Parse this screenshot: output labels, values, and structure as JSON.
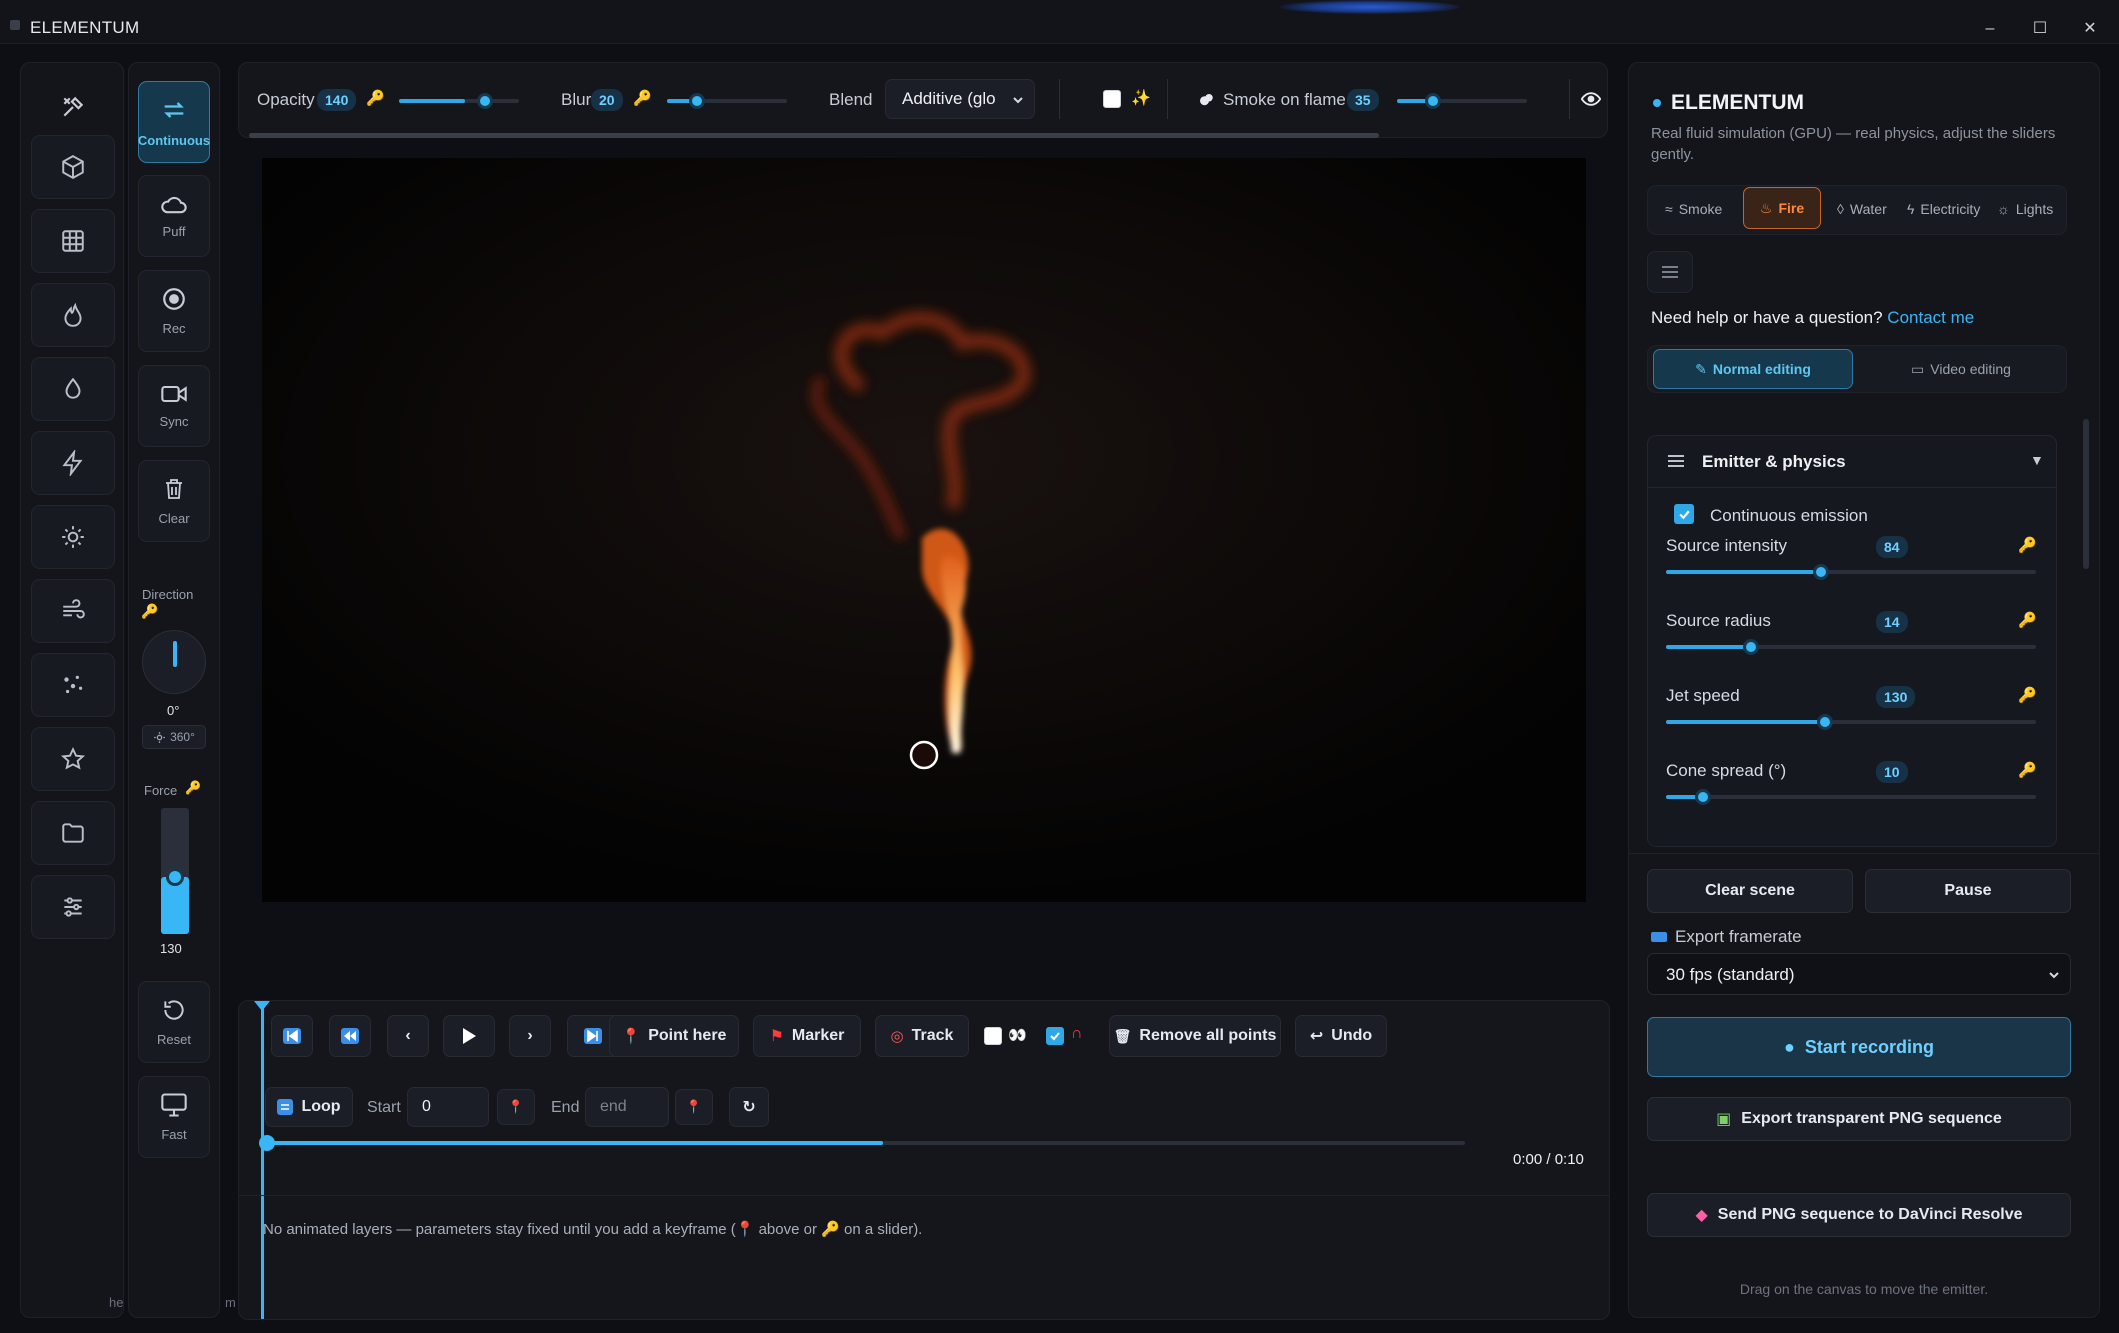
{
  "window": {
    "title": "ELEMENTUM",
    "controls": [
      "–",
      "☐",
      "✕"
    ]
  },
  "left_rail": {
    "icons": [
      "tools-icon",
      "cube-icon",
      "grid-icon",
      "flame-icon",
      "droplet-icon",
      "bolt-icon",
      "sun-icon",
      "wind-icon",
      "particles-icon",
      "star-icon",
      "folder-icon",
      "sliders-icon"
    ],
    "footer_label": "he"
  },
  "tools": {
    "continuous": "Continuous",
    "puff": "Puff",
    "rec": "Rec",
    "sync": "Sync",
    "clear": "Clear",
    "direction_label": "Direction",
    "direction_value": "0°",
    "direction_360": "360°",
    "force_label": "Force",
    "force_value": "130",
    "force_level": 0.45,
    "reset": "Reset",
    "fast": "Fast",
    "footer_label": "m"
  },
  "topbar": {
    "opacity_label": "Opacity",
    "opacity_value": "140",
    "blur_label": "Blur",
    "blur_value": "20",
    "blend_label": "Blend",
    "blend_value": "Additive (glo",
    "smoke_label": "Smoke on flame",
    "smoke_value": "35"
  },
  "timeline": {
    "point_here": "Point here",
    "marker": "Marker",
    "track": "Track",
    "remove_all": "Remove all points",
    "undo": "Undo",
    "loop": "Loop",
    "start_label": "Start",
    "start_value": "0",
    "end_label": "End",
    "end_placeholder": "end",
    "time": "0:00 / 0:10",
    "progress": 0.5,
    "hint_a": "No animated layers — parameters stay fixed until you add a keyframe (",
    "hint_b": "above or",
    "hint_c": "on a slider)."
  },
  "panel": {
    "title": "ELEMENTUM",
    "subtitle": "Real fluid simulation (GPU) — real physics, adjust the sliders gently.",
    "tabs": [
      "Smoke",
      "Fire",
      "Water",
      "Electricity",
      "Lights"
    ],
    "active_tab": "Fire",
    "help_text": "Need help or have a question?",
    "help_link": "Contact me",
    "mode_normal": "Normal editing",
    "mode_video": "Video editing",
    "section_title": "Emitter & physics",
    "continuous_emission": "Continuous emission",
    "sliders": [
      {
        "name": "Source intensity",
        "value": "84",
        "level": 0.42
      },
      {
        "name": "Source radius",
        "value": "14",
        "level": 0.23
      },
      {
        "name": "Jet speed",
        "value": "130",
        "level": 0.43
      },
      {
        "name": "Cone spread (°)",
        "value": "10",
        "level": 0.1
      }
    ],
    "clear_scene": "Clear scene",
    "pause": "Pause",
    "export_framerate_label": "Export framerate",
    "framerate_value": "30 fps (standard)",
    "start_recording": "Start recording",
    "export_png": "Export transparent PNG sequence",
    "send_davinci": "Send PNG sequence to DaVinci Resolve",
    "footer_hint": "Drag on the canvas to move the emitter."
  },
  "colors": {
    "accent": "#38b6f6",
    "accent_dark": "#16384c",
    "fire": "#e46a1f",
    "bg": "#0d0f14"
  }
}
